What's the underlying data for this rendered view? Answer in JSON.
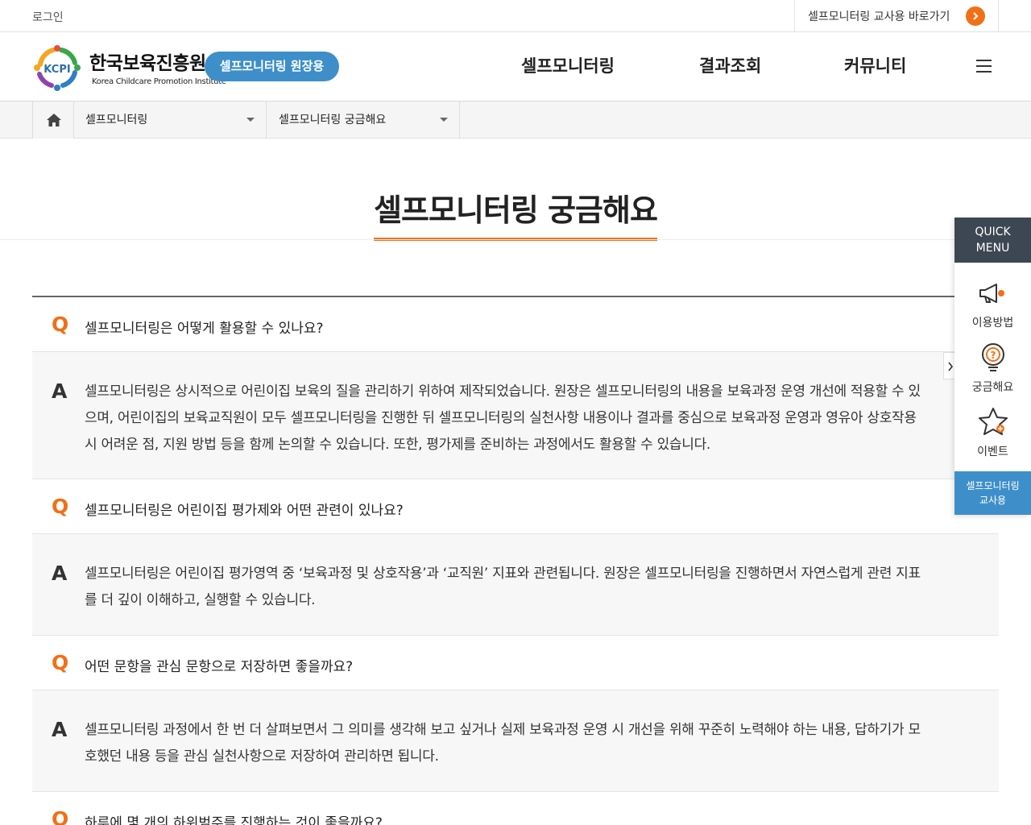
{
  "topbar": {
    "login": "로그인",
    "teacher_link": "셀프모니터링 교사용 바로가기"
  },
  "header": {
    "logo_ko": "한국보육진흥원",
    "logo_en": "Korea Childcare Promotion Institute",
    "logo_mark": "KCPI",
    "role_badge": "셀프모니터링 원장용",
    "nav": [
      "셀프모니터링",
      "결과조회",
      "커뮤니티"
    ]
  },
  "breadcrumb": {
    "level1": "셀프모니터링",
    "level2": "셀프모니터링 궁금해요"
  },
  "page": {
    "title": "셀프모니터링 궁금해요"
  },
  "faq": {
    "q_mark": "Q",
    "a_mark": "A",
    "items": [
      {
        "q": "셀프모니터링은 어떻게 활용할 수 있나요?",
        "a": "셀프모니터링은 상시적으로 어린이집 보육의 질을 관리하기 위하여 제작되었습니다. 원장은 셀프모니터링의 내용을 보육과정 운영 개선에 적용할 수 있으며, 어린이집의 보육교직원이 모두 셀프모니터링을 진행한 뒤 셀프모니터링의 실천사항 내용이나 결과를 중심으로 보육과정 운영과 영유아 상호작용 시 어려운 점, 지원 방법 등을 함께 논의할 수 있습니다. 또한, 평가제를 준비하는 과정에서도 활용할 수 있습니다."
      },
      {
        "q": "셀프모니터링은 어린이집 평가제와 어떤 관련이 있나요?",
        "a": "셀프모니터링은 어린이집 평가영역 중 ‘보육과정 및 상호작용’과 ‘교직원’ 지표와 관련됩니다. 원장은 셀프모니터링을 진행하면서 자연스럽게 관련 지표를 더 깊이 이해하고, 실행할 수 있습니다."
      },
      {
        "q": "어떤 문항을 관심 문항으로 저장하면 좋을까요?",
        "a": "셀프모니터링 과정에서 한 번 더 살펴보면서 그 의미를 생각해 보고 싶거나 실제 보육과정 운영 시 개선을 위해 꾸준히 노력해야 하는 내용, 답하기가 모호했던 내용 등을 관심 실천사항으로 저장하여 관리하면 됩니다."
      },
      {
        "q": "하루에 몇 개의 하위범주를 진행하는 것이 좋을까요?",
        "a": ""
      }
    ]
  },
  "quick_menu": {
    "head_line1": "QUICK",
    "head_line2": "MENU",
    "items": [
      "이용방법",
      "궁금해요",
      "이벤트"
    ],
    "foot_line1": "셀프모니터링",
    "foot_line2": "교사용"
  },
  "colors": {
    "accent": "#f26f16",
    "brand_blue": "#3e8fc9",
    "quick_head": "#3d4753"
  }
}
